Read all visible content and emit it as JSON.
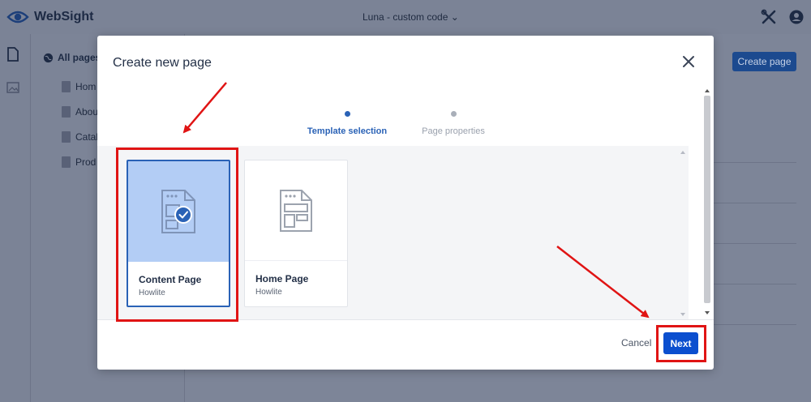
{
  "app": {
    "name": "WebSight",
    "project": "Luna - custom code",
    "project_caret": "⌄"
  },
  "tree": {
    "heading": "All pages",
    "items": [
      "Hom",
      "Abou",
      "Catal",
      "Prod"
    ]
  },
  "background": {
    "create_page_label": "Create page"
  },
  "modal": {
    "title": "Create new page",
    "steps": [
      {
        "label": "Template selection",
        "active": true
      },
      {
        "label": "Page properties",
        "active": false
      }
    ],
    "templates": [
      {
        "name": "Content Page",
        "source": "Howlite",
        "selected": true
      },
      {
        "name": "Home Page",
        "source": "Howlite",
        "selected": false
      }
    ],
    "cancel_label": "Cancel",
    "next_label": "Next"
  },
  "colors": {
    "accent": "#0b4fcf",
    "active_step": "#2a62b6",
    "selected_card_bg": "#b3cdf5",
    "annotation": "#e01414"
  }
}
